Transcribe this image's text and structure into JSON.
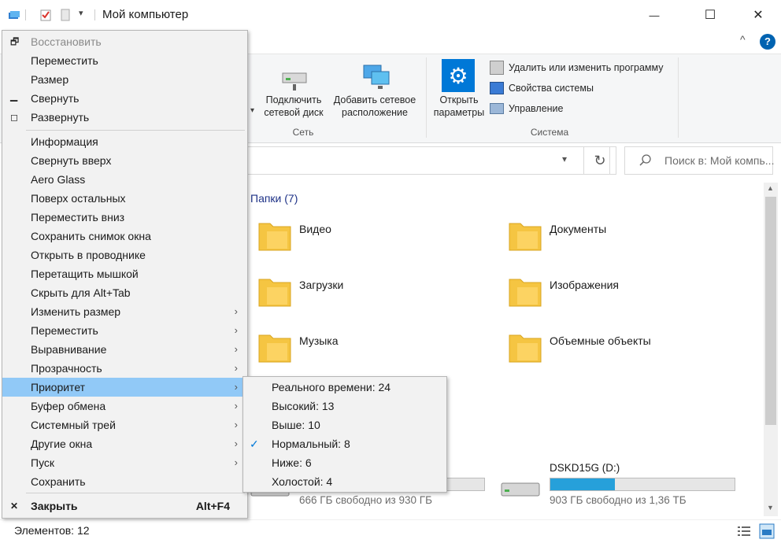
{
  "window": {
    "title": "Мой компьютер",
    "minimize_glyph": "—",
    "maximize_glyph": "☐",
    "close_glyph": "✕",
    "help_glyph": "?",
    "ribbon_collapse_glyph": "^"
  },
  "ribbon": {
    "map_drive": "Подключить\nсетевой диск",
    "add_location": "Добавить сетевое\nрасположение",
    "network_group": "Сеть",
    "open_settings": "Открыть\nпараметры",
    "uninstall": "Удалить или изменить программу",
    "system_props": "Свойства системы",
    "manage": "Управление",
    "system_group": "Система"
  },
  "address": {
    "search_placeholder": "Поиск в: Мой компь..."
  },
  "content": {
    "folders_header": "Папки (7)",
    "folders": [
      {
        "name": "Видео",
        "icon": "video-folder-icon"
      },
      {
        "name": "Документы",
        "icon": "documents-folder-icon"
      },
      {
        "name": "Загрузки",
        "icon": "downloads-folder-icon"
      },
      {
        "name": "Изображения",
        "icon": "pictures-folder-icon"
      },
      {
        "name": "Музыка",
        "icon": "music-folder-icon"
      },
      {
        "name": "Объемные объекты",
        "icon": "3d-objects-folder-icon"
      }
    ],
    "drives": [
      {
        "name": "",
        "free": "666 ГБ свободно из 930 ГБ",
        "used_fraction": 0.28
      },
      {
        "name": "DSKD15G (D:)",
        "free": "903 ГБ свободно из 1,36 ТБ",
        "used_fraction": 0.35
      }
    ]
  },
  "status": {
    "items": "Элементов: 12"
  },
  "menu": {
    "items": [
      {
        "label": "Восстановить",
        "icon": "restore",
        "disabled": true
      },
      {
        "label": "Переместить"
      },
      {
        "label": "Размер"
      },
      {
        "label": "Свернуть",
        "icon": "minimize"
      },
      {
        "label": "Развернуть",
        "icon": "maximize"
      },
      {
        "label": "Информация"
      },
      {
        "label": "Свернуть вверх"
      },
      {
        "label": "Aero Glass"
      },
      {
        "label": "Поверх остальных"
      },
      {
        "label": "Переместить вниз"
      },
      {
        "label": "Сохранить снимок окна"
      },
      {
        "label": "Открыть в проводнике"
      },
      {
        "label": "Перетащить мышкой"
      },
      {
        "label": "Скрыть для Alt+Tab"
      },
      {
        "label": "Изменить размер",
        "submenu": true
      },
      {
        "label": "Переместить",
        "submenu": true
      },
      {
        "label": "Выравнивание",
        "submenu": true
      },
      {
        "label": "Прозрачность",
        "submenu": true
      },
      {
        "label": "Приоритет",
        "submenu": true,
        "highlighted": true
      },
      {
        "label": "Буфер обмена",
        "submenu": true
      },
      {
        "label": "Системный трей",
        "submenu": true
      },
      {
        "label": "Другие окна",
        "submenu": true
      },
      {
        "label": "Пуск",
        "submenu": true
      },
      {
        "label": "Сохранить"
      }
    ],
    "close_label": "Закрыть",
    "close_shortcut": "Alt+F4",
    "close_glyph": "✕",
    "arrow_glyph": "›"
  },
  "priority_submenu": {
    "items": [
      {
        "label": "Реального времени: 24"
      },
      {
        "label": "Высокий: 13"
      },
      {
        "label": "Выше: 10"
      },
      {
        "label": "Нормальный: 8",
        "checked": true
      },
      {
        "label": "Ниже: 6"
      },
      {
        "label": "Холостой: 4"
      }
    ],
    "check_glyph": "✓"
  },
  "colors": {
    "highlight": "#91c9f7",
    "accent": "#0078d7",
    "folder": "#f5c542"
  }
}
